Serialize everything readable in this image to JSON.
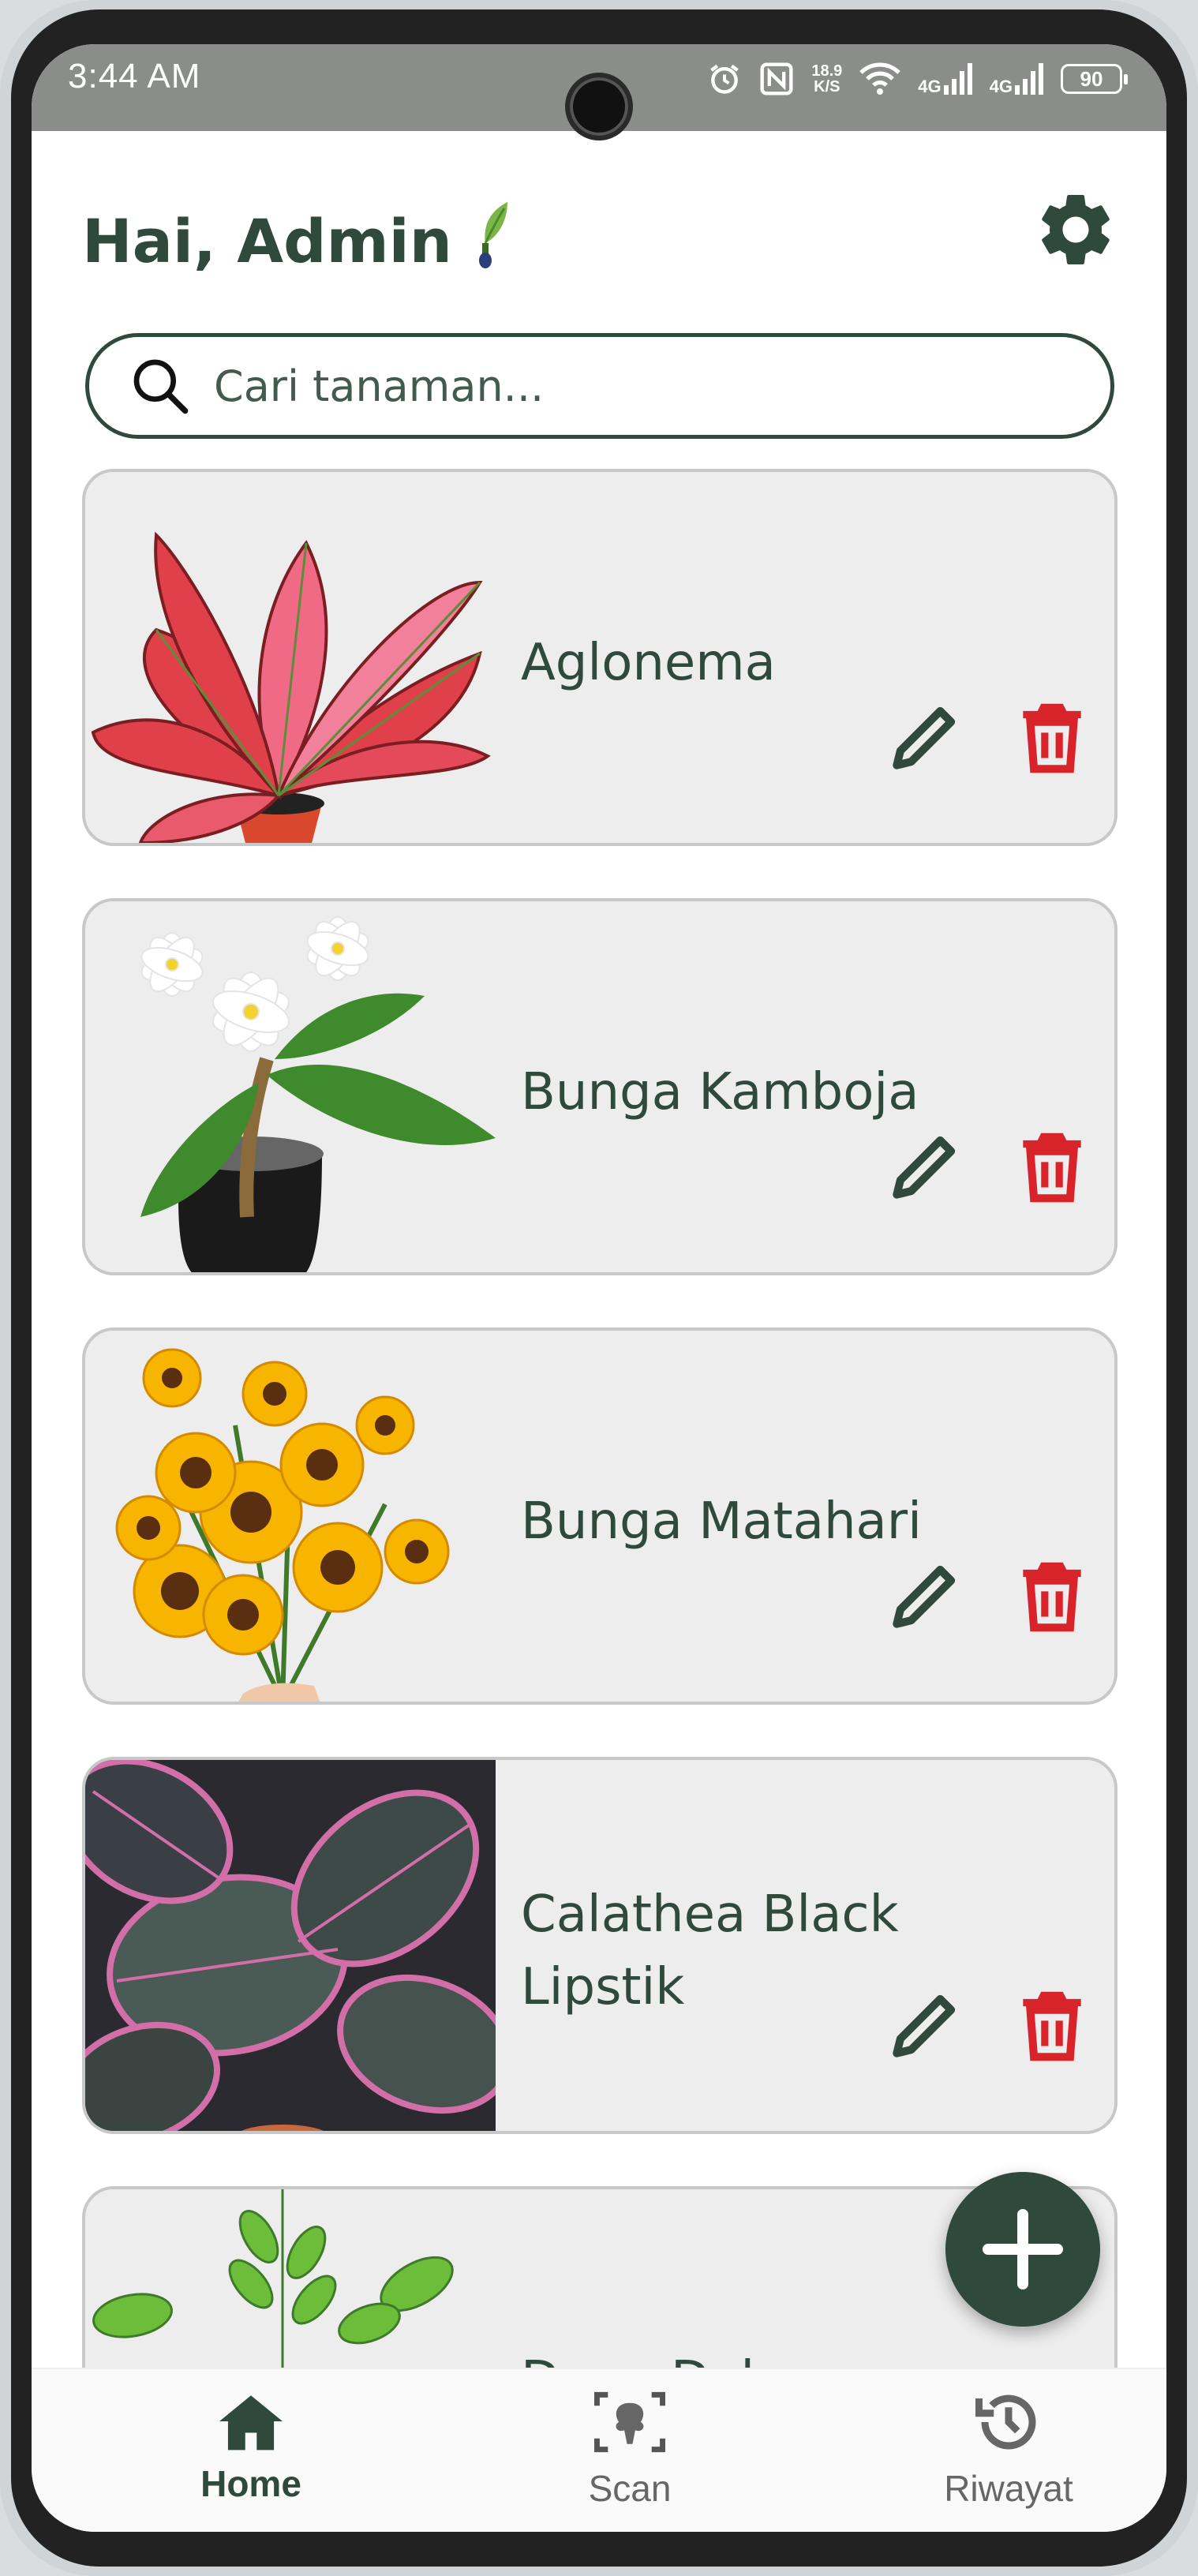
{
  "status_bar": {
    "time": "3:44 AM",
    "net_speed_value": "18.9",
    "net_speed_unit": "K/S",
    "signal1": "4G",
    "signal2": "4G",
    "battery": "90"
  },
  "header": {
    "greeting": "Hai, Admin",
    "settings_icon": "gear-icon"
  },
  "search": {
    "placeholder": "Cari tanaman..."
  },
  "plants": [
    {
      "name": "Aglonema"
    },
    {
      "name": "Bunga Kamboja"
    },
    {
      "name": "Bunga Matahari"
    },
    {
      "name": "Calathea Black Lipstik"
    },
    {
      "name": "Daun Dolar"
    }
  ],
  "fab": {
    "icon": "plus-icon"
  },
  "nav": {
    "home": "Home",
    "scan": "Scan",
    "history": "Riwayat"
  },
  "colors": {
    "primary": "#2f4a3d",
    "delete": "#d9232b",
    "card_bg": "#ededed",
    "status_bar": "#8a8d8a"
  }
}
